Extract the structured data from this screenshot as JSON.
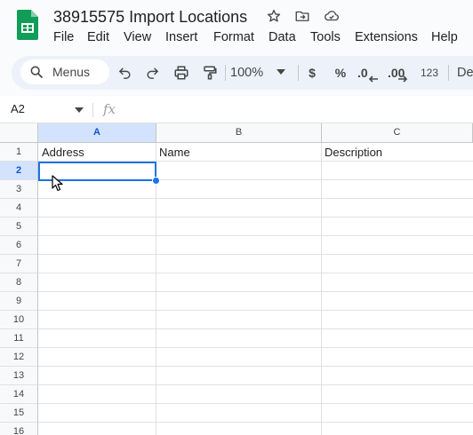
{
  "window": {
    "title": "38915575 Import Locations"
  },
  "menu": {
    "items": [
      "File",
      "Edit",
      "View",
      "Insert",
      "Format",
      "Data",
      "Tools",
      "Extensions",
      "Help"
    ]
  },
  "toolbar": {
    "search_label": "Menus",
    "zoom": "100%",
    "currency": "$",
    "percent": "%",
    "decrease_decimal": ".0",
    "increase_decimal": ".00",
    "number_format": "123",
    "font_partial": "De"
  },
  "formula_bar": {
    "cell_ref": "A2",
    "fx_label": "fx",
    "value": ""
  },
  "sheet": {
    "columns": [
      "A",
      "B",
      "C"
    ],
    "rows": [
      "1",
      "2",
      "3",
      "4",
      "5",
      "6",
      "7",
      "8",
      "9",
      "10",
      "11",
      "12",
      "13",
      "14",
      "15",
      "16"
    ],
    "header_row": [
      "Address",
      "Name",
      "Description"
    ],
    "selected_column": "A",
    "selected_row": "2"
  },
  "colors": {
    "accent": "#1a73e8",
    "selected_header_bg": "#d3e3fd",
    "logo_green": "#0f9d58"
  },
  "icons": {
    "logo": "sheets-logo-icon",
    "star": "star-icon",
    "move": "move-to-folder-icon",
    "cloud": "cloud-saved-icon",
    "search": "search-icon",
    "undo": "undo-icon",
    "redo": "redo-icon",
    "print": "print-icon",
    "paint_format": "paint-format-icon"
  }
}
